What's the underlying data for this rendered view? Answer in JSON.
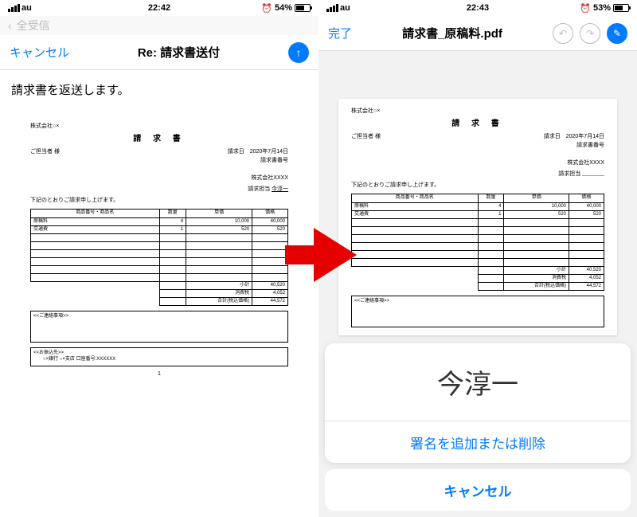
{
  "left": {
    "status": {
      "carrier": "au",
      "time": "22:42",
      "battery": "54%"
    },
    "nav": {
      "cancel": "キャンセル",
      "title": "Re: 請求書送付"
    },
    "body": "請求書を返送します。",
    "page": "1"
  },
  "right": {
    "status": {
      "carrier": "au",
      "time": "22:43",
      "battery": "53%"
    },
    "nav": {
      "done": "完了",
      "title": "請求書_原稿料.pdf"
    },
    "sheet": {
      "sig": "今淳一",
      "manage": "署名を追加または削除",
      "cancel": "キャンセル"
    }
  },
  "doc": {
    "company": "株式会社○×",
    "recipient": "ご担当者 様",
    "title": "請 求 書",
    "dateLabel": "請求日",
    "date": "2020年7月14日",
    "numLabel": "請求書番号",
    "from": "株式会社XXXX",
    "sigLabel": "請求担当",
    "sig": "今淳一",
    "intro": "下記のとおりご請求申し上げます。",
    "headers": {
      "item": "商品番号・商品名",
      "qty": "数量",
      "unit": "単価",
      "price": "価格"
    },
    "rows": [
      {
        "item": "原稿料",
        "qty": "4",
        "unit": "10,000",
        "price": "40,000"
      },
      {
        "item": "交通費",
        "qty": "1",
        "unit": "520",
        "price": "520"
      }
    ],
    "subtotal": {
      "label": "小計",
      "val": "40,520"
    },
    "tax": {
      "label": "消費税",
      "val": "4,052"
    },
    "total": {
      "label": "合計(税込価格)",
      "val": "44,572"
    },
    "notes": "<<ご連絡事項>>",
    "bank": {
      "h": "<<お振込先>>",
      "t": "○×銀行 ○×支店 口座番号:XXXXXX"
    }
  }
}
